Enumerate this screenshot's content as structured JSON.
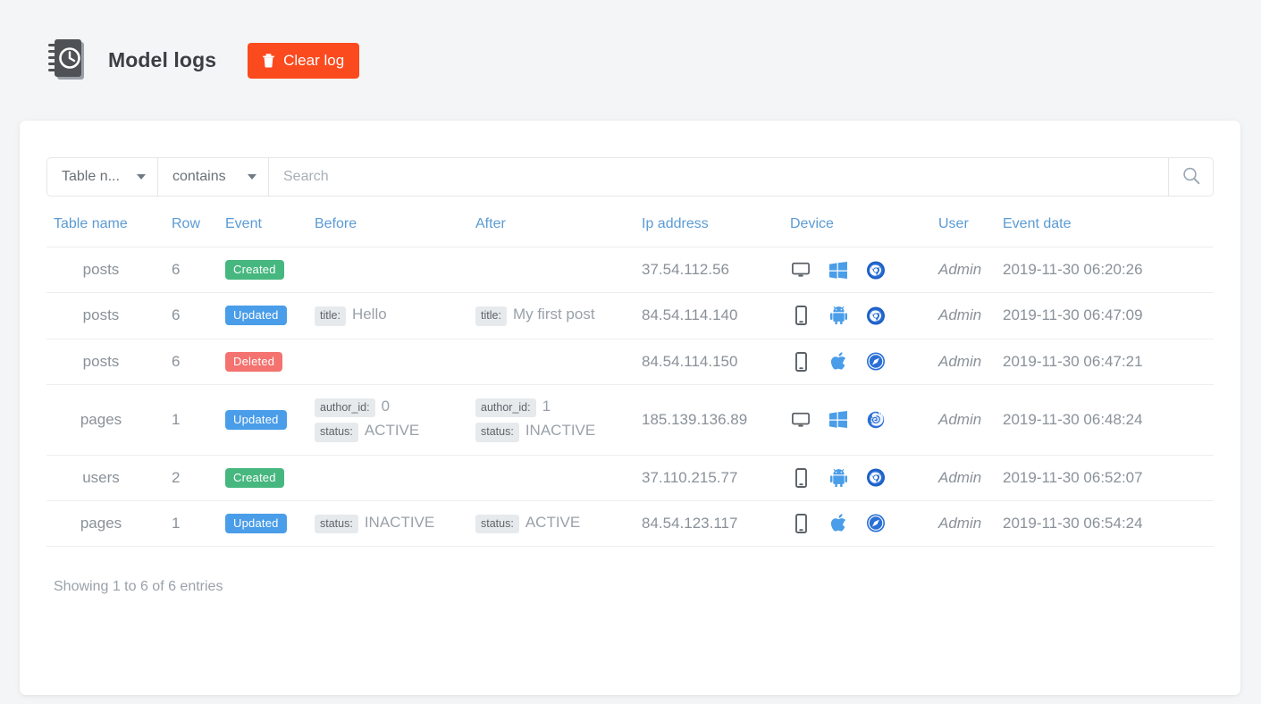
{
  "header": {
    "icon": "log-book-clock-icon",
    "title": "Model logs",
    "clear_button": {
      "label": "Clear log",
      "icon": "trash-icon",
      "color": "#fb4a1e"
    }
  },
  "filter": {
    "field_select": {
      "value": "Table n...",
      "icon": "chevron-down-icon"
    },
    "operator_select": {
      "value": "contains",
      "icon": "chevron-down-icon"
    },
    "search": {
      "value": "",
      "placeholder": "Search"
    },
    "search_button_icon": "search-icon"
  },
  "table": {
    "columns": [
      "Table name",
      "Row",
      "Event",
      "Before",
      "After",
      "Ip address",
      "Device",
      "User",
      "Event date"
    ],
    "rows": [
      {
        "table_name": "posts",
        "row": "6",
        "event": "Created",
        "event_type": "created",
        "before": [],
        "after": [],
        "ip": "37.54.112.56",
        "device": "desktop-icon",
        "os": "windows-icon",
        "browser": "chrome-icon",
        "user": "Admin",
        "date": "2019-11-30 06:20:26"
      },
      {
        "table_name": "posts",
        "row": "6",
        "event": "Updated",
        "event_type": "updated",
        "before": [
          {
            "key": "title:",
            "value": "Hello"
          }
        ],
        "after": [
          {
            "key": "title:",
            "value": "My first post"
          }
        ],
        "ip": "84.54.114.140",
        "device": "mobile-icon",
        "os": "android-icon",
        "browser": "chrome-icon",
        "user": "Admin",
        "date": "2019-11-30 06:47:09"
      },
      {
        "table_name": "posts",
        "row": "6",
        "event": "Deleted",
        "event_type": "deleted",
        "before": [],
        "after": [],
        "ip": "84.54.114.150",
        "device": "mobile-icon",
        "os": "apple-icon",
        "browser": "safari-icon",
        "user": "Admin",
        "date": "2019-11-30 06:47:21"
      },
      {
        "table_name": "pages",
        "row": "1",
        "event": "Updated",
        "event_type": "updated",
        "before": [
          {
            "key": "author_id:",
            "value": "0"
          },
          {
            "key": "status:",
            "value": "ACTIVE"
          }
        ],
        "after": [
          {
            "key": "author_id:",
            "value": "1"
          },
          {
            "key": "status:",
            "value": "INACTIVE"
          }
        ],
        "ip": "185.139.136.89",
        "device": "desktop-icon",
        "os": "windows-icon",
        "browser": "firefox-icon",
        "user": "Admin",
        "date": "2019-11-30 06:48:24"
      },
      {
        "table_name": "users",
        "row": "2",
        "event": "Created",
        "event_type": "created",
        "before": [],
        "after": [],
        "ip": "37.110.215.77",
        "device": "mobile-icon",
        "os": "android-icon",
        "browser": "chrome-icon",
        "user": "Admin",
        "date": "2019-11-30 06:52:07"
      },
      {
        "table_name": "pages",
        "row": "1",
        "event": "Updated",
        "event_type": "updated",
        "before": [
          {
            "key": "status:",
            "value": "INACTIVE"
          }
        ],
        "after": [
          {
            "key": "status:",
            "value": "ACTIVE"
          }
        ],
        "ip": "84.54.123.117",
        "device": "mobile-icon",
        "os": "apple-icon",
        "browser": "safari-icon",
        "user": "Admin",
        "date": "2019-11-30 06:54:24"
      }
    ]
  },
  "footer": {
    "info": "Showing 1 to 6 of 6 entries"
  },
  "colors": {
    "created": "#46b77f",
    "updated": "#4a9de8",
    "deleted": "#f4726f",
    "accent": "#fb4a1e",
    "header_text": "#5b9bd5"
  }
}
